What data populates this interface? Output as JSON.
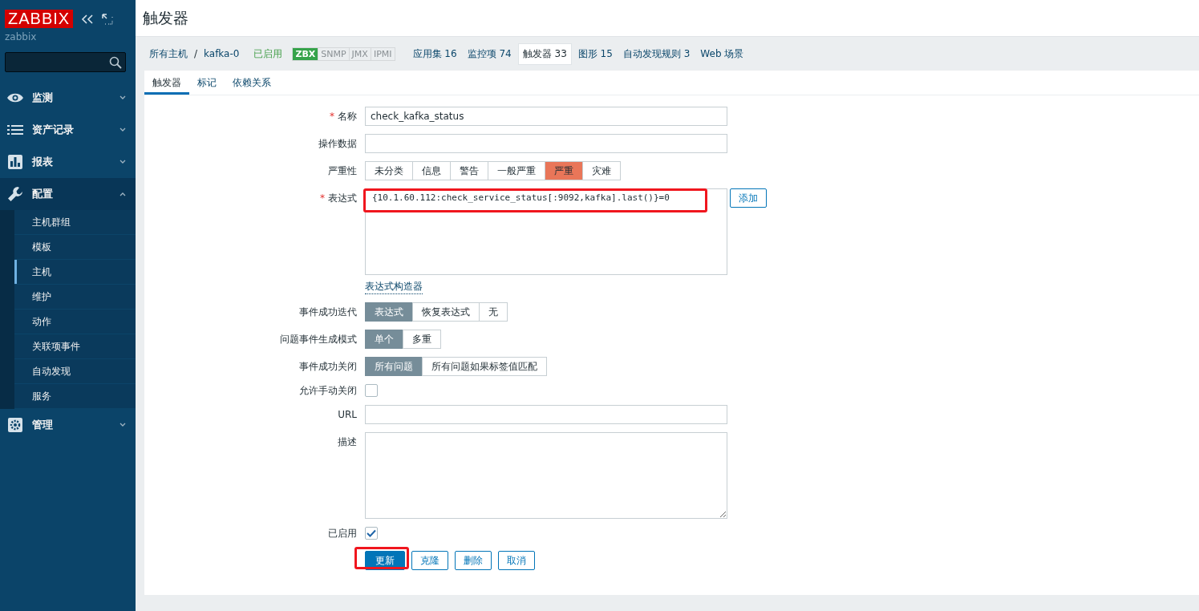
{
  "sidebar": {
    "logo": "ZABBIX",
    "server_name": "zabbix",
    "menu": [
      {
        "label": "监测",
        "expanded": false
      },
      {
        "label": "资产记录",
        "expanded": false
      },
      {
        "label": "报表",
        "expanded": false
      },
      {
        "label": "配置",
        "expanded": true,
        "children": [
          {
            "label": "主机群组",
            "selected": false
          },
          {
            "label": "模板",
            "selected": false
          },
          {
            "label": "主机",
            "selected": true
          },
          {
            "label": "维护",
            "selected": false
          },
          {
            "label": "动作",
            "selected": false
          },
          {
            "label": "关联项事件",
            "selected": false
          },
          {
            "label": "自动发现",
            "selected": false
          },
          {
            "label": "服务",
            "selected": false
          }
        ]
      },
      {
        "label": "管理",
        "expanded": false
      }
    ]
  },
  "page_title": "触发器",
  "host_nav": {
    "breadcrumb": [
      "所有主机",
      "kafka-0"
    ],
    "separator": "/",
    "status": "已启用",
    "availability": [
      {
        "label": "ZBX",
        "on": true
      },
      {
        "label": "SNMP",
        "on": false
      },
      {
        "label": "JMX",
        "on": false
      },
      {
        "label": "IPMI",
        "on": false
      }
    ],
    "links": [
      {
        "label": "应用集 16",
        "selected": false
      },
      {
        "label": "监控项 74",
        "selected": false
      },
      {
        "label": "触发器 33",
        "selected": true
      },
      {
        "label": "图形 15",
        "selected": false
      },
      {
        "label": "自动发现规则 3",
        "selected": false
      },
      {
        "label": "Web 场景",
        "selected": false
      }
    ]
  },
  "tabs": [
    {
      "label": "触发器",
      "selected": true
    },
    {
      "label": "标记",
      "selected": false
    },
    {
      "label": "依赖关系",
      "selected": false
    }
  ],
  "form": [
    {
      "kind": "text",
      "label": "名称",
      "required_mark": "*",
      "value": "check_kafka_status"
    },
    {
      "kind": "text",
      "label": "操作数据"
    },
    {
      "kind": "severity",
      "label": "严重性",
      "options": [
        {
          "label": "未分类",
          "selected": false
        },
        {
          "label": "信息",
          "selected": false
        },
        {
          "label": "警告",
          "selected": false
        },
        {
          "label": "一般严重",
          "selected": false
        },
        {
          "label": "严重",
          "selected": true
        },
        {
          "label": "灾难",
          "selected": false
        }
      ]
    },
    {
      "kind": "expression",
      "label": "表达式",
      "required_mark": "*",
      "value": "{10.1.60.112:check_service_status[:9092,kafka].last()}=0",
      "button": "添加",
      "link": "表达式构造器",
      "annotated": true
    },
    {
      "kind": "radio",
      "label": "事件成功迭代",
      "options": [
        {
          "label": "表达式",
          "selected": true
        },
        {
          "label": "恢复表达式",
          "selected": false
        },
        {
          "label": "无",
          "selected": false
        }
      ]
    },
    {
      "kind": "radio",
      "label": "问题事件生成模式",
      "options": [
        {
          "label": "单个",
          "selected": true
        },
        {
          "label": "多重",
          "selected": false
        }
      ]
    },
    {
      "kind": "radio",
      "label": "事件成功关闭",
      "options": [
        {
          "label": "所有问题",
          "selected": true
        },
        {
          "label": "所有问题如果标签值匹配",
          "selected": false
        }
      ]
    },
    {
      "kind": "checkbox",
      "label": "允许手动关闭",
      "checked": false
    },
    {
      "kind": "text",
      "label": "URL"
    },
    {
      "kind": "textarea",
      "label": "描述"
    },
    {
      "kind": "checkbox",
      "label": "已启用",
      "checked": true
    }
  ],
  "buttons": [
    {
      "label": "更新",
      "primary": true,
      "annotated": true
    },
    {
      "label": "克隆",
      "primary": false,
      "annotated": false
    },
    {
      "label": "删除",
      "primary": false,
      "annotated": false
    },
    {
      "label": "取消",
      "primary": false,
      "annotated": false
    }
  ]
}
